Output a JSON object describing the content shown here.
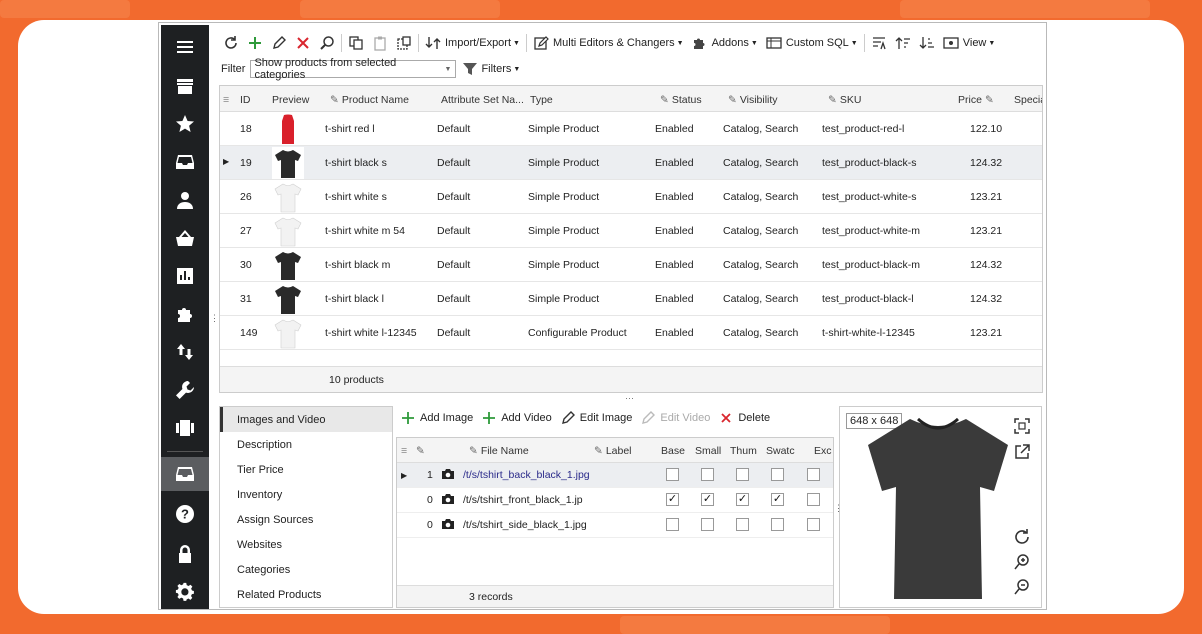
{
  "toolbar": {
    "import_export": "Import/Export",
    "multi_editors": "Multi Editors & Changers",
    "addons": "Addons",
    "custom_sql": "Custom SQL",
    "view": "View"
  },
  "filter": {
    "label": "Filter",
    "selected": "Show products from selected categories",
    "filters_button": "Filters"
  },
  "grid": {
    "columns": [
      "ID",
      "Preview",
      "Product Name",
      "Attribute Set Na...",
      "Type",
      "Status",
      "Visibility",
      "SKU",
      "Price",
      "Specia"
    ],
    "rows": [
      {
        "id": "18",
        "name": "t-shirt  red l",
        "attr": "Default",
        "type": "Simple Product",
        "status": "Enabled",
        "visibility": "Catalog, Search",
        "sku": "test_product-red-l",
        "price": "122.10",
        "color": "#d9202b"
      },
      {
        "id": "19",
        "name": "t-shirt  black s",
        "attr": "Default",
        "type": "Simple Product",
        "status": "Enabled",
        "visibility": "Catalog, Search",
        "sku": "test_product-black-s",
        "price": "124.32",
        "color": "#2a2a2a"
      },
      {
        "id": "26",
        "name": "t-shirt  white s",
        "attr": "Default",
        "type": "Simple Product",
        "status": "Enabled",
        "visibility": "Catalog, Search",
        "sku": "test_product-white-s",
        "price": "123.21",
        "color": "#f2f2f2"
      },
      {
        "id": "27",
        "name": "t-shirt  white m 54",
        "attr": "Default",
        "type": "Simple Product",
        "status": "Enabled",
        "visibility": "Catalog, Search",
        "sku": "test_product-white-m",
        "price": "123.21",
        "color": "#f2f2f2"
      },
      {
        "id": "30",
        "name": "t-shirt  black m",
        "attr": "Default",
        "type": "Simple Product",
        "status": "Enabled",
        "visibility": "Catalog, Search",
        "sku": "test_product-black-m",
        "price": "124.32",
        "color": "#2a2a2a"
      },
      {
        "id": "31",
        "name": "t-shirt  black l",
        "attr": "Default",
        "type": "Simple Product",
        "status": "Enabled",
        "visibility": "Catalog, Search",
        "sku": "test_product-black-l",
        "price": "124.32",
        "color": "#2a2a2a"
      },
      {
        "id": "149",
        "name": "t-shirt  white l-12345",
        "attr": "Default",
        "type": "Configurable Product",
        "status": "Enabled",
        "visibility": "Catalog, Search",
        "sku": "t-shirt-white-l-12345",
        "price": "123.21",
        "color": "#f2f2f2"
      }
    ],
    "footer": "10 products"
  },
  "tabs": [
    "Images and Video",
    "Description",
    "Tier Price",
    "Inventory",
    "Assign Sources",
    "Websites",
    "Categories",
    "Related Products"
  ],
  "images": {
    "add_image": "Add Image",
    "add_video": "Add Video",
    "edit_image": "Edit Image",
    "edit_video": "Edit Video",
    "delete": "Delete",
    "columns": [
      "File Name",
      "Label",
      "Base",
      "Small",
      "Thum",
      "Swatc",
      "Exc"
    ],
    "rows": [
      {
        "pos": "1",
        "file": "/t/s/tshirt_back_black_1.jpg",
        "checks": [
          false,
          false,
          false,
          false,
          false
        ]
      },
      {
        "pos": "0",
        "file": "/t/s/tshirt_front_black_1.jp",
        "checks": [
          true,
          true,
          true,
          true,
          false
        ]
      },
      {
        "pos": "0",
        "file": "/t/s/tshirt_side_black_1.jpg",
        "checks": [
          false,
          false,
          false,
          false,
          false
        ]
      }
    ],
    "footer": "3 records"
  },
  "preview": {
    "dimensions": "648 x 648",
    "shirt_color": "#3a3a3a"
  },
  "colors": {
    "background": "#f26a2e",
    "sidebar": "#1e2022"
  }
}
